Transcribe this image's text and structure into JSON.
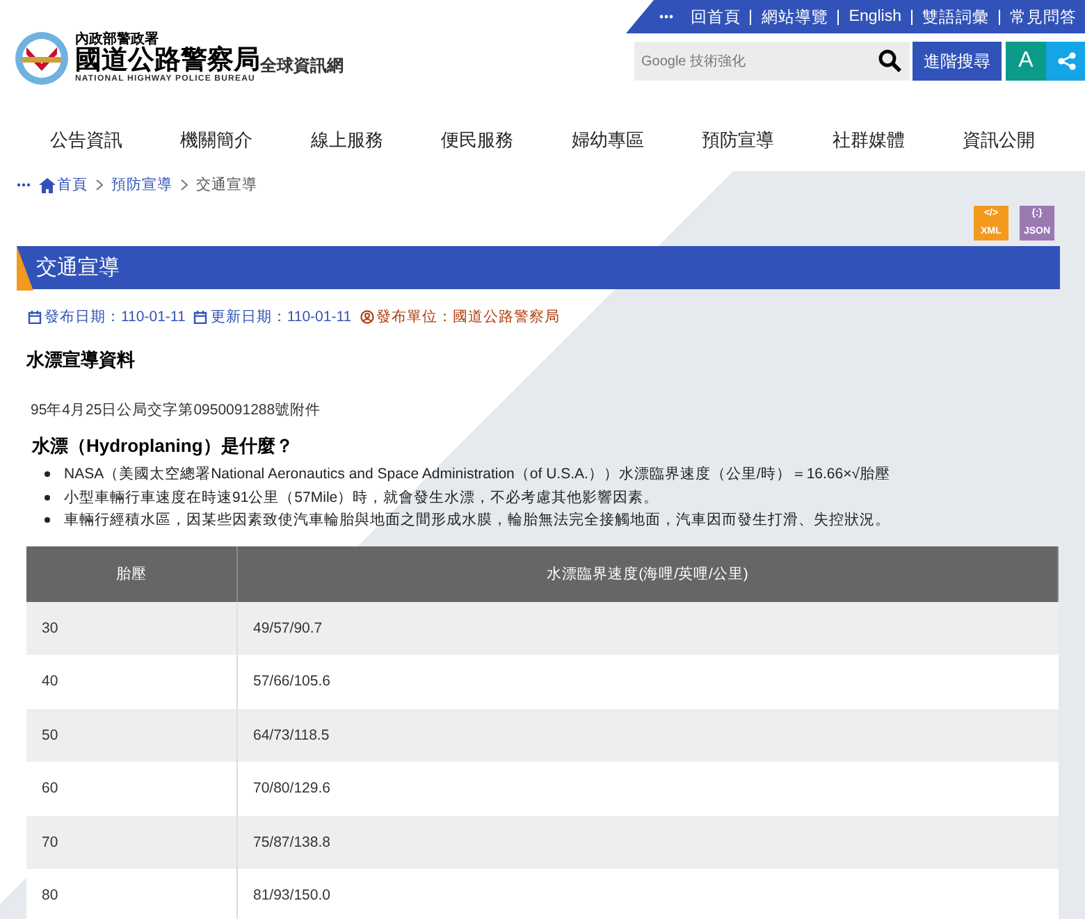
{
  "utility_links": [
    "回首頁",
    "網站導覽",
    "English",
    "雙語詞彙",
    "常見問答"
  ],
  "logo": {
    "ministry": "內政部警政署",
    "name": "國道公路警察局",
    "suffix": "全球資訊網",
    "english": "NATIONAL HIGHWAY POLICE BUREAU"
  },
  "search": {
    "placeholder": "Google 技術強化",
    "advanced_button": "進階搜尋",
    "font_button": "A"
  },
  "nav": [
    "公告資訊",
    "機關簡介",
    "線上服務",
    "便民服務",
    "婦幼專區",
    "預防宣導",
    "社群媒體",
    "資訊公開"
  ],
  "breadcrumb": [
    {
      "label": "首頁",
      "kind": "home"
    },
    {
      "label": "預防宣導",
      "kind": "link"
    },
    {
      "label": "交通宣導",
      "kind": "current"
    }
  ],
  "exports": [
    {
      "label": "XML",
      "glyph": "</>",
      "color": "#f39a1e"
    },
    {
      "label": "JSON",
      "glyph": "{:}",
      "color": "#9b79b3"
    }
  ],
  "page_title": "交通宣導",
  "meta": [
    {
      "label": "發布日期：110-01-11",
      "kind": "date"
    },
    {
      "label": "更新日期：110-01-11",
      "kind": "date"
    },
    {
      "label": "發布單位：國道公路警察局",
      "kind": "unit"
    }
  ],
  "heading": "水漂宣導資料",
  "document_ref": "95年4月25日公局交字第0950091288號附件",
  "subheading": "水漂（Hydroplaning）是什麼？",
  "bullets": [
    "NASA（美國太空總署National Aeronautics and Space Administration（of U.S.A.））水漂臨界速度（公里/時）＝16.66×√胎壓",
    "小型車輛行車速度在時速91公里（57Mile）時，就會發生水漂，不必考慮其他影響因素。",
    "車輛行經積水區，因某些因素致使汽車輪胎與地面之間形成水膜，輪胎無法完全接觸地面，汽車因而發生打滑、失控狀況。"
  ],
  "table": {
    "columns": [
      "胎壓",
      "水漂臨界速度(海哩/英哩/公里)"
    ],
    "rows": [
      [
        "30",
        "49/57/90.7"
      ],
      [
        "40",
        "57/66/105.6"
      ],
      [
        "50",
        "64/73/118.5"
      ],
      [
        "60",
        "70/80/129.6"
      ],
      [
        "70",
        "75/87/138.8"
      ],
      [
        "80",
        "81/93/150.0"
      ]
    ]
  }
}
